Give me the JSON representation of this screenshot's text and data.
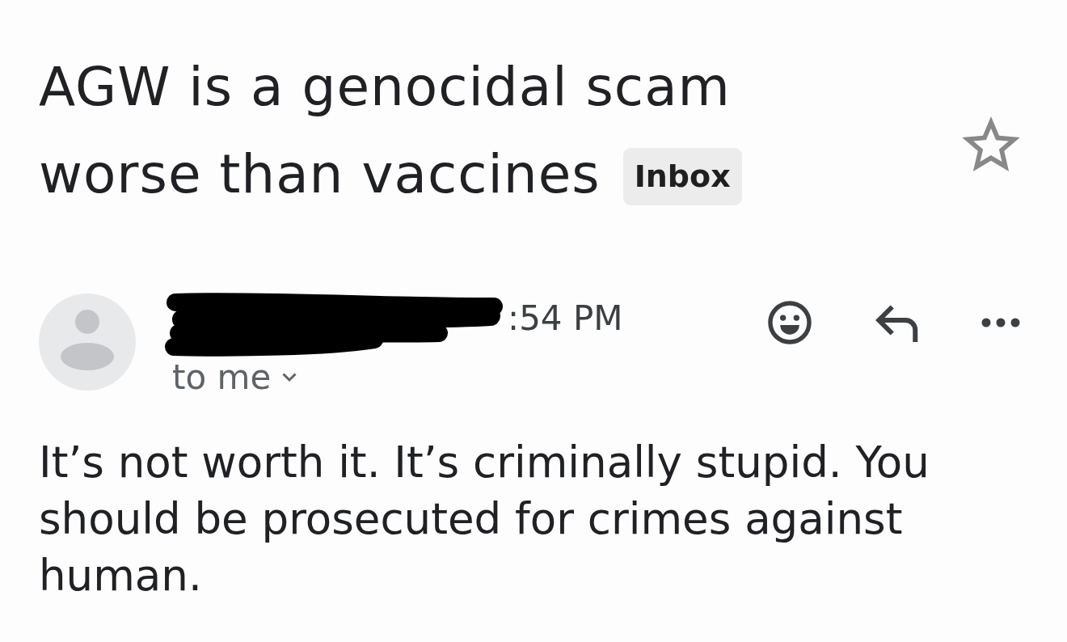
{
  "subject": {
    "title_lines": [
      "AGW is a genocidal scam",
      "worse than vaccines"
    ],
    "label": "Inbox",
    "starred": false
  },
  "message": {
    "time": ":54 PM",
    "recipient": "to me"
  },
  "body": "It’s not worth it. It’s criminally stupid. You should be prosecuted for crimes against human."
}
